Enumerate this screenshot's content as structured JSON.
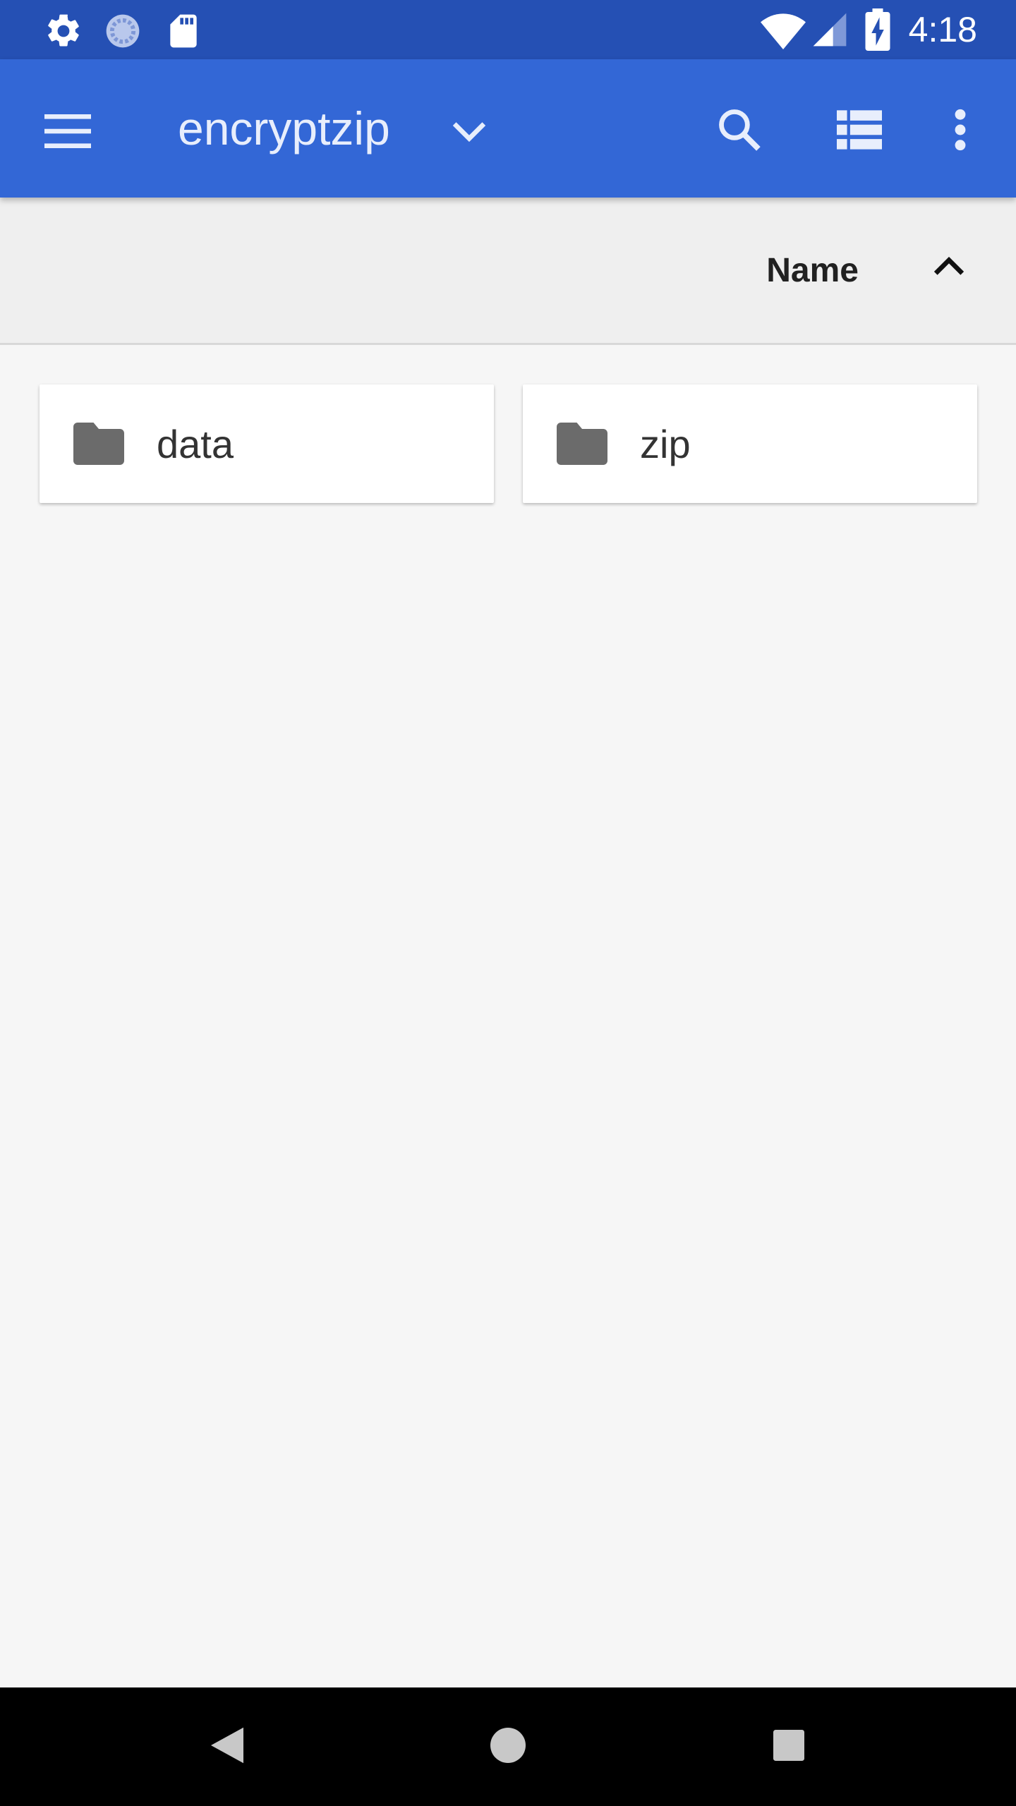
{
  "status_bar": {
    "time": "4:18",
    "left_icons": [
      "gear-icon",
      "sync-icon",
      "sd-card-icon"
    ],
    "right_icons": [
      "wifi-icon",
      "signal-icon",
      "battery-charging-icon"
    ]
  },
  "app_bar": {
    "title": "encryptzip",
    "actions": [
      "menu-icon",
      "dropdown-icon",
      "search-icon",
      "list-view-icon",
      "more-vert-icon"
    ]
  },
  "sort_header": {
    "label": "Name",
    "direction": "ascending"
  },
  "items": [
    {
      "name": "data",
      "type": "folder"
    },
    {
      "name": "zip",
      "type": "folder"
    }
  ],
  "nav_bar": {
    "buttons": [
      "back-icon",
      "home-icon",
      "recents-icon"
    ]
  },
  "colors": {
    "status_bar": "#2550b4",
    "app_bar": "#3367d6",
    "background": "#f6f6f6",
    "folder_icon": "#6b6b6b"
  }
}
